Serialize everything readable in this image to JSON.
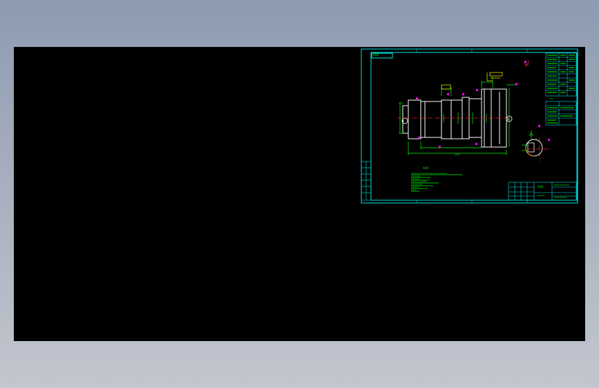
{
  "colors": {
    "background_top": "#8E9BB0",
    "background_bottom": "#C2C6CE",
    "model_space": "#000000",
    "frame": "#00E5E5",
    "geometry": "#FFFFFF",
    "dimension": "#00FF00",
    "centerline": "#FF2020",
    "marker": "#FF00FF",
    "note_text": "#FFFF00"
  },
  "drawing": {
    "title_label": "XXX",
    "table_label": "XXX",
    "note_title": "XXX",
    "tech_notes": [
      "XXXXXXXXXXXXXXXXXXXXXXXXXXXXXXXXXXXXXX",
      "XXXXXXXXXX",
      "XXXXXXXXX",
      "XXXXXXXXXXXXXXXX",
      "XXXXXXXXXXXX",
      "XXXXXXXXX",
      "XXXXX"
    ],
    "title_block": {
      "part_name": "XXX",
      "drawing_number": "XXXXXXXXXXX",
      "material": "XXXXX",
      "company": "XXXXXXXXX"
    },
    "datum_a": "A",
    "datum_b": "B",
    "roughness": "XX",
    "dim_length": "XXXX",
    "dim_tol": "XXXXXXX"
  }
}
